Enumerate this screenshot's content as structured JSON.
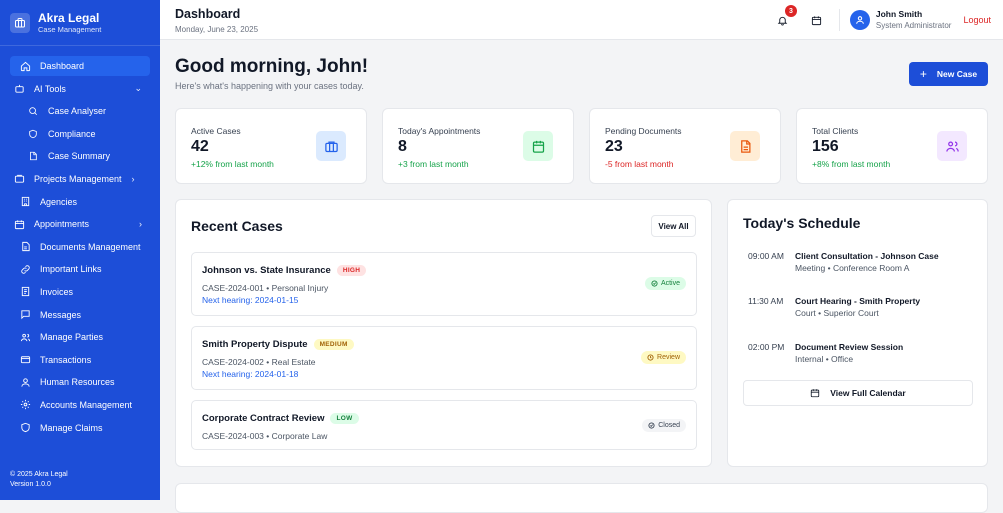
{
  "app": {
    "name": "Akra Legal",
    "subtitle": "Case Management"
  },
  "sidebar": {
    "items": [
      {
        "label": "Dashboard",
        "icon": "home-icon",
        "active": true
      },
      {
        "label": "AI Tools",
        "icon": "robot-icon",
        "chevron": "down"
      },
      {
        "label": "Case Analyser",
        "icon": "search-icon",
        "sub": true
      },
      {
        "label": "Compliance",
        "icon": "shield-icon",
        "sub": true
      },
      {
        "label": "Case Summary",
        "icon": "document-icon",
        "sub": true
      },
      {
        "label": "Projects Management",
        "icon": "briefcase-icon",
        "chevron": "right"
      },
      {
        "label": "Agencies",
        "icon": "building-icon"
      },
      {
        "label": "Appointments",
        "icon": "calendar-icon",
        "chevron": "right"
      },
      {
        "label": "Documents Management",
        "icon": "file-icon"
      },
      {
        "label": "Important Links",
        "icon": "link-icon"
      },
      {
        "label": "Invoices",
        "icon": "receipt-icon"
      },
      {
        "label": "Messages",
        "icon": "message-icon"
      },
      {
        "label": "Manage Parties",
        "icon": "users-icon"
      },
      {
        "label": "Transactions",
        "icon": "credit-card-icon"
      },
      {
        "label": "Human Resources",
        "icon": "user-icon"
      },
      {
        "label": "Accounts Management",
        "icon": "gear-icon"
      },
      {
        "label": "Manage Claims",
        "icon": "shield-icon"
      }
    ],
    "footer": {
      "copyright": "© 2025 Akra Legal",
      "version": "Version 1.0.0"
    }
  },
  "header": {
    "title": "Dashboard",
    "date": "Monday, June 23, 2025",
    "notification_count": "3",
    "user": {
      "name": "John Smith",
      "role": "System Administrator"
    },
    "logout_label": "Logout"
  },
  "greeting": {
    "title": "Good morning, John!",
    "subtitle": "Here's what's happening with your cases today."
  },
  "new_case_label": "New Case",
  "stats": [
    {
      "label": "Active Cases",
      "value": "42",
      "change": "+12% from last month",
      "change_color": "#16a34a",
      "icon": "briefcase-icon",
      "icon_bg": "#dbeafe",
      "icon_color": "#2563eb"
    },
    {
      "label": "Today's Appointments",
      "value": "8",
      "change": "+3 from last month",
      "change_color": "#16a34a",
      "icon": "calendar-icon",
      "icon_bg": "#dcfce7",
      "icon_color": "#16a34a"
    },
    {
      "label": "Pending Documents",
      "value": "23",
      "change": "-5 from last month",
      "change_color": "#dc2626",
      "icon": "document-icon",
      "icon_bg": "#ffedd5",
      "icon_color": "#ea580c"
    },
    {
      "label": "Total Clients",
      "value": "156",
      "change": "+8% from last month",
      "change_color": "#16a34a",
      "icon": "users-icon",
      "icon_bg": "#f3e8ff",
      "icon_color": "#9333ea"
    }
  ],
  "recent_cases": {
    "title": "Recent Cases",
    "view_all_label": "View All",
    "items": [
      {
        "title": "Johnson vs. State Insurance",
        "priority": "HIGH",
        "meta": "CASE-2024-001 • Personal Injury",
        "hearing": "Next hearing: 2024-01-15",
        "status": "Active"
      },
      {
        "title": "Smith Property Dispute",
        "priority": "MEDIUM",
        "meta": "CASE-2024-002 • Real Estate",
        "hearing": "Next hearing: 2024-01-18",
        "status": "Review"
      },
      {
        "title": "Corporate Contract Review",
        "priority": "LOW",
        "meta": "CASE-2024-003 • Corporate Law",
        "hearing": "",
        "status": "Closed"
      }
    ]
  },
  "schedule": {
    "title": "Today's Schedule",
    "items": [
      {
        "time": "09:00 AM",
        "event": "Client Consultation - Johnson Case",
        "details": "Meeting • Conference Room A"
      },
      {
        "time": "11:30 AM",
        "event": "Court Hearing - Smith Property",
        "details": "Court • Superior Court"
      },
      {
        "time": "02:00 PM",
        "event": "Document Review Session",
        "details": "Internal • Office"
      }
    ],
    "view_calendar_label": "View Full Calendar"
  }
}
